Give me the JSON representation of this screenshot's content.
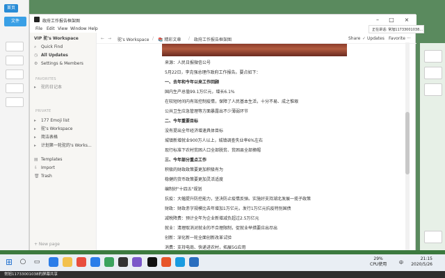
{
  "desktop": {
    "top_button": "首页",
    "tab_label": "文件"
  },
  "window": {
    "title": "政府工作报告框架图",
    "menu": [
      "File",
      "Edit",
      "View",
      "Window",
      "Help"
    ],
    "controls": {
      "minimize": "–",
      "maximize": "□",
      "close": "×"
    }
  },
  "sidebar": {
    "workspace": "VIP 驼's Workspace",
    "nav": [
      {
        "icon": "search-icon",
        "label": "Quick Find"
      },
      {
        "icon": "clock-icon",
        "label": "All Updates"
      },
      {
        "icon": "gear-icon",
        "label": "Settings & Members"
      }
    ],
    "favorites_heading": "FAVORITES",
    "favorites": [
      "驼的日记本"
    ],
    "private_heading": "PRIVATE",
    "private": [
      "177 Emoji list",
      "驼's Workspace",
      "简洁表格",
      "计划第一轮驼的's Works..."
    ],
    "bottom": [
      {
        "icon": "template-icon",
        "label": "Templates"
      },
      {
        "icon": "import-icon",
        "label": "Import"
      },
      {
        "icon": "trash-icon",
        "label": "Trash"
      }
    ],
    "new_page": "+ New page"
  },
  "topbar": {
    "breadcrumb": [
      "驼's Workspace",
      "/",
      "📚 精彩文章",
      "/",
      "政府工作报告框架图"
    ],
    "share": "Share",
    "updates": "Updates",
    "favorite": "Favorite",
    "more": "···"
  },
  "document": {
    "lines": [
      {
        "text": "来源：人民日报微信公号",
        "heading": false
      },
      {
        "text": "5月22日，李克强总理作政府工作报告。要点如下：",
        "heading": false
      },
      {
        "text": "一、去年和今年以来工作回顾",
        "heading": true
      },
      {
        "text": "国内生产总值99.1万亿元，增长6.1%",
        "heading": false
      },
      {
        "text": "在较短时间内有效控制疫情，保障了人民基本生活，十分不易、成之惟艰",
        "heading": false
      },
      {
        "text": "公共卫生应急管理等方面暴露出不少薄弱环节",
        "heading": false
      },
      {
        "text": "二、今年重要目标",
        "heading": true
      },
      {
        "text": "没有提出全年经济增速具体目标",
        "heading": false
      },
      {
        "text": "城镇新增就业900万人以上，城镇调查失业率6%左右",
        "heading": false
      },
      {
        "text": "现行标准下农村贫困人口全部脱贫、贫困县全部摘帽",
        "heading": false
      },
      {
        "text": "三、今年部分重点工作",
        "heading": true
      },
      {
        "text": "积极的财政政策要更加积极有为",
        "heading": false
      },
      {
        "text": "稳健的货币政策要更加灵活适度",
        "heading": false
      },
      {
        "text": "编制好\"十四五\"规划",
        "heading": false
      },
      {
        "text": "抗疫：大幅提升防控能力，坚决防止疫情反弹。实施好支持湖北发展一揽子政策",
        "heading": false
      },
      {
        "text": "财政：财政赤字规模比去年增加1万亿元，发行1万亿元抗疫特别国债",
        "heading": false
      },
      {
        "text": "减税降费：预计全年为企业新增减负超过2.5万亿元",
        "heading": false
      },
      {
        "text": "就业：清理取消对就业的不合理限制，促就业举措要应出尽出",
        "heading": false
      },
      {
        "text": "创新：深化新一轮全面创新改革试验",
        "heading": false
      },
      {
        "text": "消费：支持电商、快递进农村，拓展5G应用",
        "heading": false
      },
      {
        "text": "投资：积极扩大有效投资，今年拟安排地方政府专项债券3.75万亿元",
        "heading": false
      }
    ]
  },
  "notification": {
    "text": "正在讲话: 常旭11733001038..."
  },
  "taskbar": {
    "cpu_value": "29%",
    "cpu_label": "CPU使用",
    "time": "21:15",
    "date": "2020/5/26",
    "lang": "中"
  },
  "statusline": {
    "text": "常旭11733001038的屏幕共享"
  }
}
